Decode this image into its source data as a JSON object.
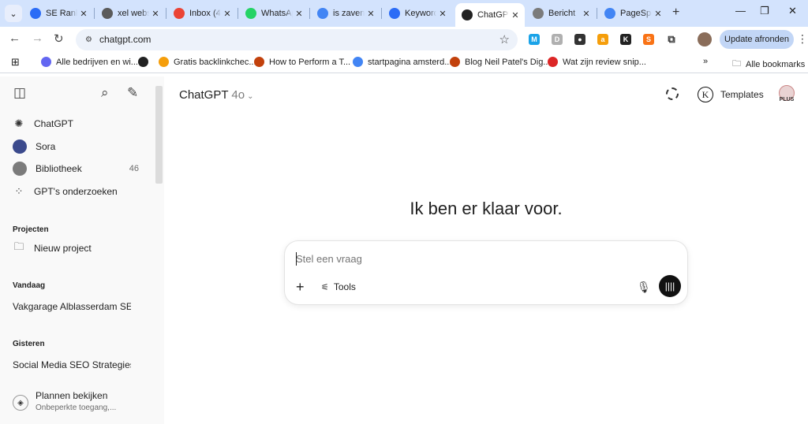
{
  "browser": {
    "tabs": [
      {
        "title": "SE Ranking",
        "icon": "se-ranking-icon",
        "color": "#2b6cf6",
        "active": false
      },
      {
        "title": "xel website",
        "icon": "anon-icon",
        "color": "#5b5b5b",
        "active": false
      },
      {
        "title": "Inbox (4",
        "icon": "gmail-icon",
        "color": "#ea4335",
        "active": false
      },
      {
        "title": "WhatsApp",
        "icon": "whatsapp-icon",
        "color": "#25d366",
        "active": false
      },
      {
        "title": "is zaven",
        "icon": "google-icon",
        "color": "#4285f4",
        "active": false
      },
      {
        "title": "Keyword",
        "icon": "se-ranking-icon",
        "color": "#2b6cf6",
        "active": false
      },
      {
        "title": "ChatGPT",
        "icon": "openai-icon",
        "color": "#222222",
        "active": true
      },
      {
        "title": "Bericht",
        "icon": "globe-icon",
        "color": "#7b7b7b",
        "active": false
      },
      {
        "title": "PageSpeed",
        "icon": "pagespeed-icon",
        "color": "#4285f4",
        "active": false
      }
    ],
    "close_glyph": "✕",
    "new_tab": "+",
    "url": "chatgpt.com",
    "update_button": "Update afronden",
    "extensions": [
      {
        "icon": "m-ext-icon",
        "letter": "M",
        "color": "#1aa3e8"
      },
      {
        "icon": "d-ext-icon",
        "letter": "D",
        "color": "#b0b0b0"
      },
      {
        "icon": "mask-ext-icon",
        "letter": "●",
        "color": "#333333"
      },
      {
        "icon": "amazon-ext-icon",
        "letter": "a",
        "color": "#f59e0b"
      },
      {
        "icon": "k-ext-icon",
        "letter": "K",
        "color": "#222222"
      },
      {
        "icon": "seo-ext-icon",
        "letter": "S",
        "color": "#f97316"
      },
      {
        "icon": "puzzle-icon",
        "letter": "⧉",
        "color": "#ffffff"
      }
    ],
    "bookmarks": [
      {
        "label": "Alle bedrijven en wi...",
        "icon": "arrow-bm-icon",
        "color": "#6366f1"
      },
      {
        "label": "",
        "icon": "globe-bm-icon",
        "color": "#222222"
      },
      {
        "label": "Gratis backlinkchec...",
        "icon": "ahrefs-bm-icon",
        "color": "#f59e0b"
      },
      {
        "label": "How to Perform a T...",
        "icon": "neil-bm-icon",
        "color": "#c2410c"
      },
      {
        "label": "startpagina amsterd...",
        "icon": "google-bm-icon",
        "color": "#4285f4"
      },
      {
        "label": "Blog Neil Patel's Dig...",
        "icon": "neil-bm-icon",
        "color": "#c2410c"
      },
      {
        "label": "Wat zijn review snip...",
        "icon": "review-bm-icon",
        "color": "#dc2626"
      }
    ],
    "all_bookmarks": "Alle bookmarks",
    "overflow": "»"
  },
  "sidebar": {
    "nav": [
      {
        "label": "ChatGPT",
        "icon": "openai-icon",
        "count": ""
      },
      {
        "label": "Sora",
        "icon": "sora-icon",
        "count": ""
      },
      {
        "label": "Bibliotheek",
        "icon": "library-icon",
        "count": "46"
      },
      {
        "label": "GPT's onderzoeken",
        "icon": "grid-icon",
        "count": ""
      }
    ],
    "projects_heading": "Projecten",
    "new_project": "Nieuw project",
    "today_heading": "Vandaag",
    "today_items": [
      "Vakgarage Alblasserdam SEO"
    ],
    "yesterday_heading": "Gisteren",
    "yesterday_items": [
      "Social Media SEO Strategies"
    ],
    "plans_title": "Plannen bekijken",
    "plans_sub": "Onbeperkte toegang,..."
  },
  "main": {
    "model_name": "ChatGPT",
    "model_version": "4o",
    "templates_label": "Templates",
    "plus_badge": "PLUS",
    "k_letter": "K",
    "heading": "Ik ben er klaar voor.",
    "composer_placeholder": "Stel een vraag",
    "tools_label": "Tools"
  }
}
